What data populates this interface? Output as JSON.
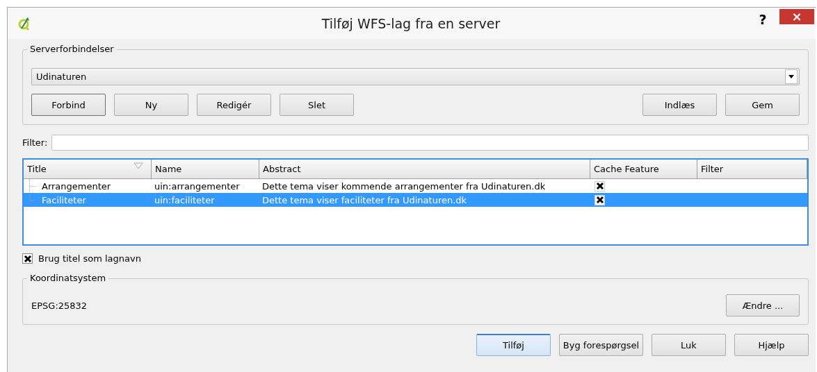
{
  "window": {
    "title": "Tilføj WFS-lag fra en server",
    "help": "?",
    "close": "×"
  },
  "server_connections": {
    "legend": "Serverforbindelser",
    "selected_server": "Udinaturen",
    "left_buttons": [
      {
        "label": "Forbind",
        "default": true
      },
      {
        "label": "Ny",
        "default": false
      },
      {
        "label": "Redigér",
        "default": false
      },
      {
        "label": "Slet",
        "default": false
      }
    ],
    "right_buttons": [
      "Indlæs",
      "Gem"
    ]
  },
  "filter": {
    "label": "Filter:"
  },
  "table": {
    "columns": [
      "Title",
      "Name",
      "Abstract",
      "Cache Feature",
      "Filter"
    ],
    "rows": [
      {
        "title": "Arrangementer",
        "name": "uin:arrangementer",
        "abstract": "Dette tema viser kommende arrangementer fra Udinaturen.dk",
        "cache_feature": true,
        "selected": false
      },
      {
        "title": "Faciliteter",
        "name": "uin:faciliteter",
        "abstract": "Dette tema viser faciliteter fra Udinaturen.dk",
        "cache_feature": true,
        "selected": true
      }
    ]
  },
  "use_title_as_layer_name": {
    "label": "Brug titel som lagnavn",
    "checked": true
  },
  "coordinate_system": {
    "legend": "Koordinatsystem",
    "crs": "EPSG:25832",
    "change_button": "Ændre ..."
  },
  "buttons": [
    {
      "label": "Tilføj",
      "default": true
    },
    {
      "label": "Byg forespørgsel",
      "default": false
    },
    {
      "label": "Luk",
      "default": false
    },
    {
      "label": "Hjælp",
      "default": false
    }
  ]
}
